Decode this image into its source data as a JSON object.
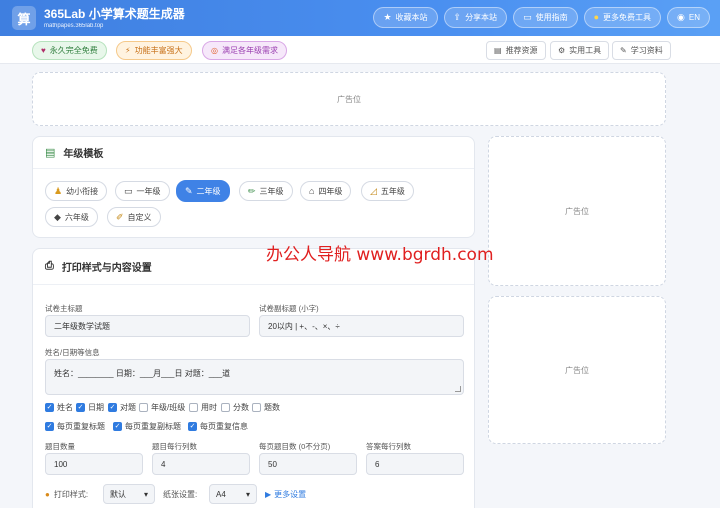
{
  "header": {
    "logo_char": "算",
    "title": "365Lab 小学算术题生成器",
    "subtitle": "mathpapes.365lab.top",
    "nav": [
      {
        "icon": "star-icon",
        "glyph": "★",
        "label": "收藏本站"
      },
      {
        "icon": "share-icon",
        "glyph": "⇪",
        "label": "分享本站"
      },
      {
        "icon": "monitor-icon",
        "glyph": "▭",
        "label": "使用指南"
      },
      {
        "icon": "bulb-icon",
        "glyph": "●",
        "label": "更多免费工具"
      },
      {
        "icon": "globe-icon",
        "glyph": "◉",
        "label": "EN"
      }
    ]
  },
  "subbar": {
    "tags": [
      {
        "glyph": "♥",
        "label": "永久完全免费"
      },
      {
        "glyph": "⚡",
        "label": "功能丰富强大"
      },
      {
        "glyph": "◎",
        "label": "满足各年级需求"
      }
    ],
    "links": [
      {
        "glyph": "▤",
        "label": "推荐资源"
      },
      {
        "glyph": "⚙",
        "label": "实用工具"
      },
      {
        "glyph": "✎",
        "label": "学习资料"
      }
    ]
  },
  "ads": {
    "top": "广告位",
    "side1": "广告位",
    "side2": "广告位"
  },
  "grade_card": {
    "title": "年级模板",
    "grades": [
      {
        "glyph": "♟",
        "label": "幼小衔接",
        "active": false
      },
      {
        "glyph": "▭",
        "label": "一年级",
        "active": false
      },
      {
        "glyph": "✎",
        "label": "二年级",
        "active": true
      },
      {
        "glyph": "✏",
        "label": "三年级",
        "active": false
      },
      {
        "glyph": "⌂",
        "label": "四年级",
        "active": false
      },
      {
        "glyph": "◿",
        "label": "五年级",
        "active": false
      },
      {
        "glyph": "◆",
        "label": "六年级",
        "active": false
      },
      {
        "glyph": "✐",
        "label": "自定义",
        "active": false
      }
    ]
  },
  "print_card": {
    "title": "打印样式与内容设置",
    "main_title_label": "试卷主标题",
    "main_title_value": "二年级数学试题",
    "sub_title_label": "试卷副标题 (小字)",
    "sub_title_value": "20以内 | +、-、×、÷",
    "info_label": "姓名/日期等信息",
    "info_value": "姓名：________  日期：___月___日  对题：___道",
    "checks_row1": [
      {
        "label": "姓名",
        "checked": true
      },
      {
        "label": "日期",
        "checked": true
      },
      {
        "label": "对题",
        "checked": true
      },
      {
        "label": "年级/班级",
        "checked": false
      },
      {
        "label": "用时",
        "checked": false
      },
      {
        "label": "分数",
        "checked": false
      },
      {
        "label": "题数",
        "checked": false
      }
    ],
    "checks_row2": [
      {
        "label": "每页重复标题",
        "checked": true
      },
      {
        "label": "每页重复副标题",
        "checked": true
      },
      {
        "label": "每页重复信息",
        "checked": true
      }
    ],
    "numbers": [
      {
        "label": "题目数量",
        "value": "100"
      },
      {
        "label": "题目每行列数",
        "value": "4"
      },
      {
        "label": "每页题目数 (0不分页)",
        "value": "50"
      },
      {
        "label": "答案每行列数",
        "value": "6"
      }
    ],
    "print_style_label": "打印样式:",
    "print_style_value": "默认",
    "paper_label": "纸张设置:",
    "paper_value": "A4",
    "more_label": "更多设置"
  },
  "watermark": "办公人导航 www.bgrdh.com",
  "colors": {
    "primary": "#3f82e6",
    "header": "#4a8ff0",
    "watermark": "#e02020"
  }
}
